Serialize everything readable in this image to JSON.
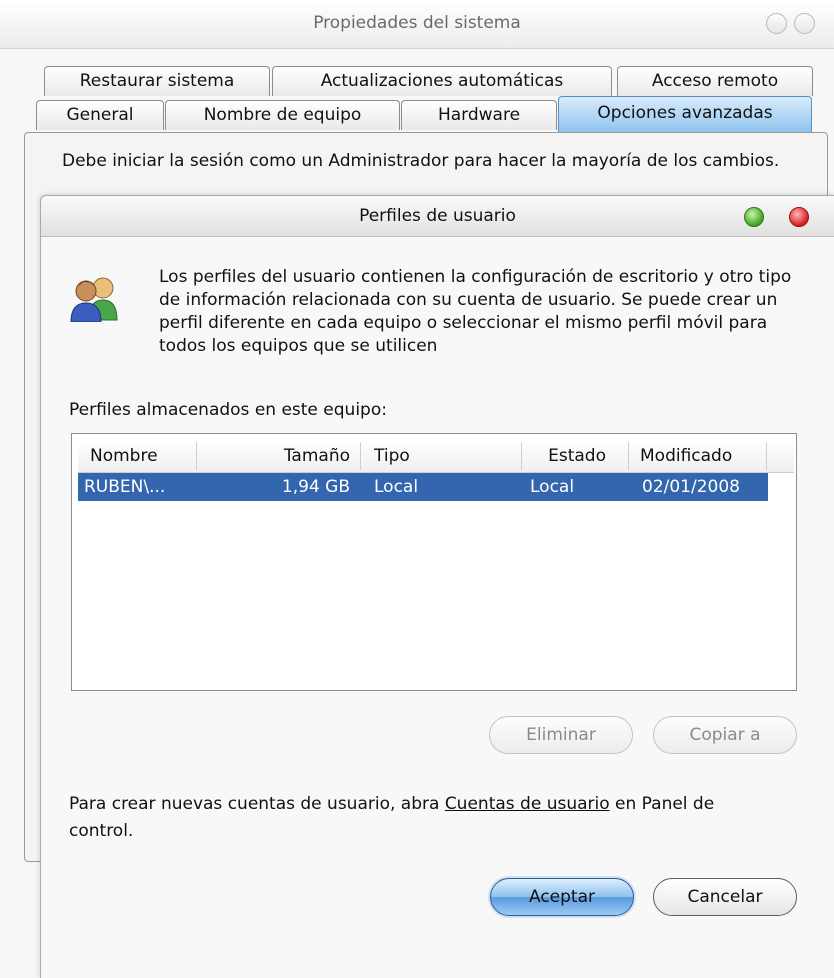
{
  "window": {
    "title": "Propiedades del sistema"
  },
  "tabs_row1": [
    {
      "label": "Restaurar sistema"
    },
    {
      "label": "Actualizaciones automáticas"
    },
    {
      "label": "Acceso remoto"
    }
  ],
  "tabs_row2": [
    {
      "label": "General"
    },
    {
      "label": "Nombre de equipo"
    },
    {
      "label": "Hardware"
    },
    {
      "label": "Opciones avanzadas",
      "active": true
    }
  ],
  "panel": {
    "notice": "Debe iniciar la sesión como un Administrador para hacer la mayoría de los cambios."
  },
  "dialog": {
    "title": "Perfiles de usuario",
    "icon": "users-icon",
    "info": "Los perfiles del usuario contienen la configuración de escritorio y otro tipo de información relacionada con su cuenta de usuario. Se puede crear un perfil diferente en cada equipo o seleccionar el mismo perfil móvil para todos los equipos que se utilicen",
    "stored_label": "Perfiles almacenados en este equipo:",
    "columns": [
      "Nombre",
      "Tamaño",
      "Tipo",
      "Estado",
      "Modificado"
    ],
    "rows": [
      {
        "nombre": "RUBEN\\...",
        "tamano": "1,94 GB",
        "tipo": "Local",
        "estado": "Local",
        "modificado": "02/01/2008",
        "selected": true
      }
    ],
    "buttons": {
      "eliminar": "Eliminar",
      "copiar": "Copiar a",
      "aceptar": "Aceptar",
      "cancelar": "Cancelar"
    },
    "footer_before": "Para crear nuevas cuentas de usuario, abra ",
    "footer_link": "Cuentas de usuario",
    "footer_after": " en Panel de control."
  },
  "colors": {
    "selection": "#3466b0",
    "active_tab": "#8fc3ee",
    "close_red": "#d41d1d",
    "zoom_green": "#3ea11f"
  }
}
